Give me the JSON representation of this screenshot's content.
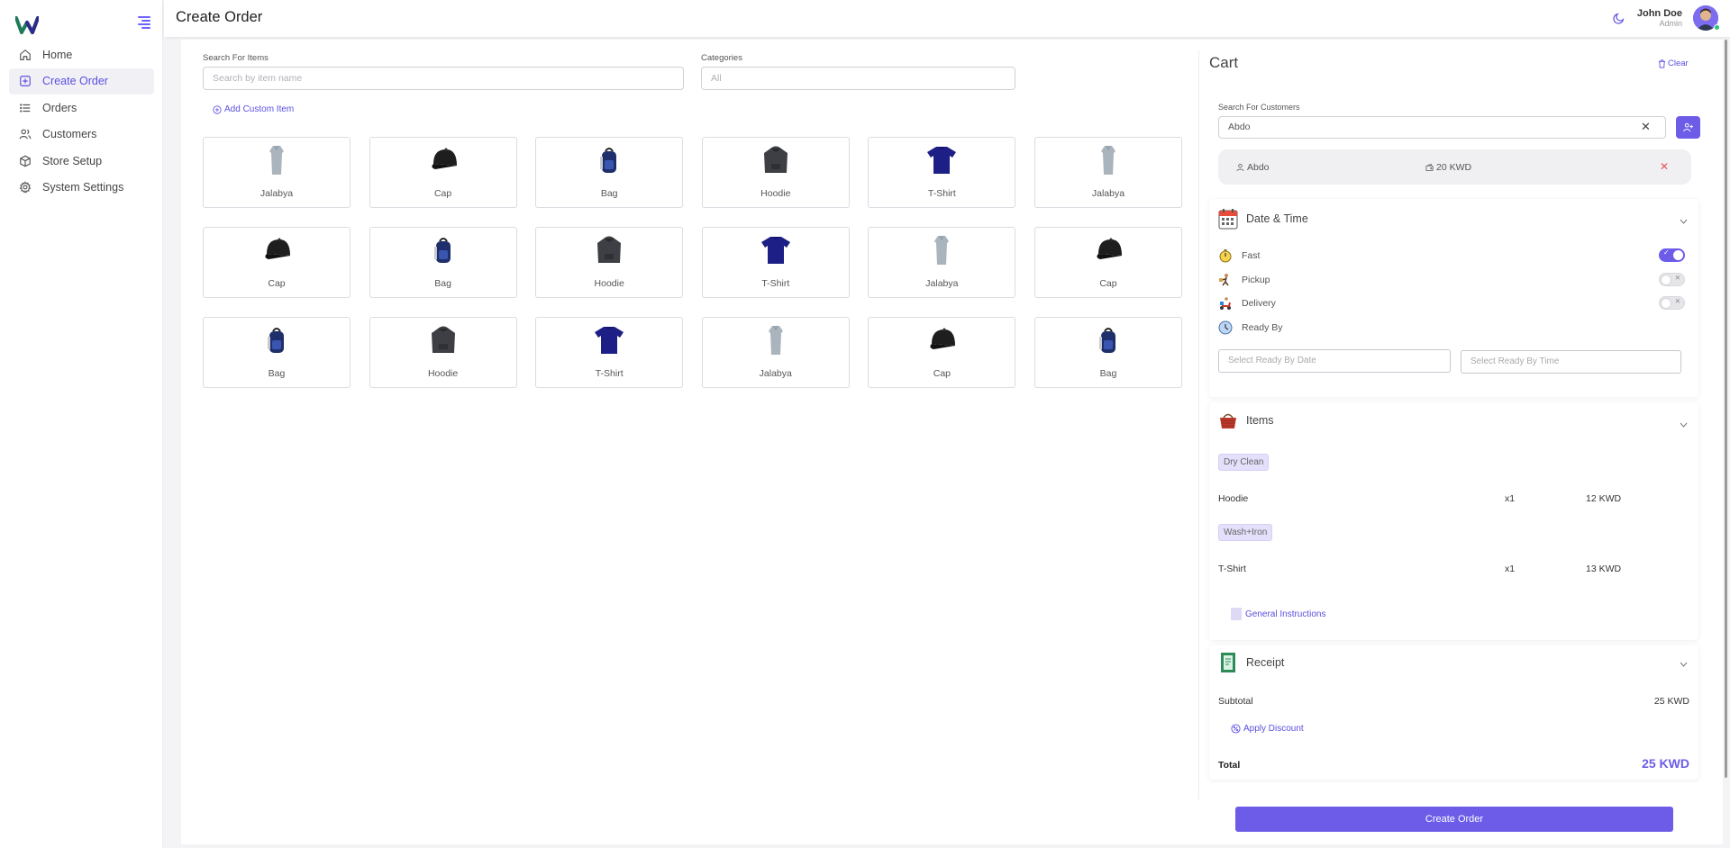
{
  "header": {
    "title": "Create Order",
    "user_name": "John Doe",
    "user_role": "Admin"
  },
  "sidebar": {
    "items": [
      {
        "label": "Home",
        "icon": "home-icon"
      },
      {
        "label": "Create Order",
        "icon": "plus-square-icon",
        "active": true
      },
      {
        "label": "Orders",
        "icon": "list-icon"
      },
      {
        "label": "Customers",
        "icon": "users-icon"
      },
      {
        "label": "Store Setup",
        "icon": "box-icon"
      },
      {
        "label": "System Settings",
        "icon": "gear-icon"
      }
    ]
  },
  "search": {
    "label": "Search For Items",
    "placeholder": "Search by item name"
  },
  "categories": {
    "label": "Categories",
    "value": "All"
  },
  "add_custom_label": "Add Custom Item",
  "items": [
    "Jalabya",
    "Cap",
    "Bag",
    "Hoodie",
    "T-Shirt",
    "Jalabya",
    "Cap",
    "Bag",
    "Hoodie",
    "T-Shirt",
    "Jalabya",
    "Cap",
    "Bag",
    "Hoodie",
    "T-Shirt",
    "Jalabya",
    "Cap",
    "Bag"
  ],
  "cart": {
    "title": "Cart",
    "clear_label": "Clear",
    "customer_label": "Search For Customers",
    "customer_value": "Abdo",
    "selected_customer": {
      "name": "Abdo",
      "balance": "20 KWD"
    }
  },
  "datetime": {
    "title": "Date & Time",
    "options": [
      {
        "label": "Fast",
        "on": true
      },
      {
        "label": "Pickup",
        "on": false
      },
      {
        "label": "Delivery",
        "on": false
      },
      {
        "label": "Ready By"
      }
    ],
    "date_placeholder": "Select Ready By Date",
    "time_placeholder": "Select Ready By Time"
  },
  "items_section": {
    "title": "Items",
    "groups": [
      {
        "service": "Dry Clean",
        "item": "Hoodie",
        "qty": "x1",
        "price": "12 KWD"
      },
      {
        "service": "Wash+Iron",
        "item": "T-Shirt",
        "qty": "x1",
        "price": "13 KWD"
      }
    ],
    "instructions_label": "General Instructions"
  },
  "receipt": {
    "title": "Receipt",
    "subtotal_label": "Subtotal",
    "subtotal_value": "25 KWD",
    "discount_label": "Apply Discount",
    "total_label": "Total",
    "total_value": "25 KWD"
  },
  "create_button": "Create Order",
  "colors": {
    "accent": "#6c5ce7",
    "danger": "#e55353"
  }
}
